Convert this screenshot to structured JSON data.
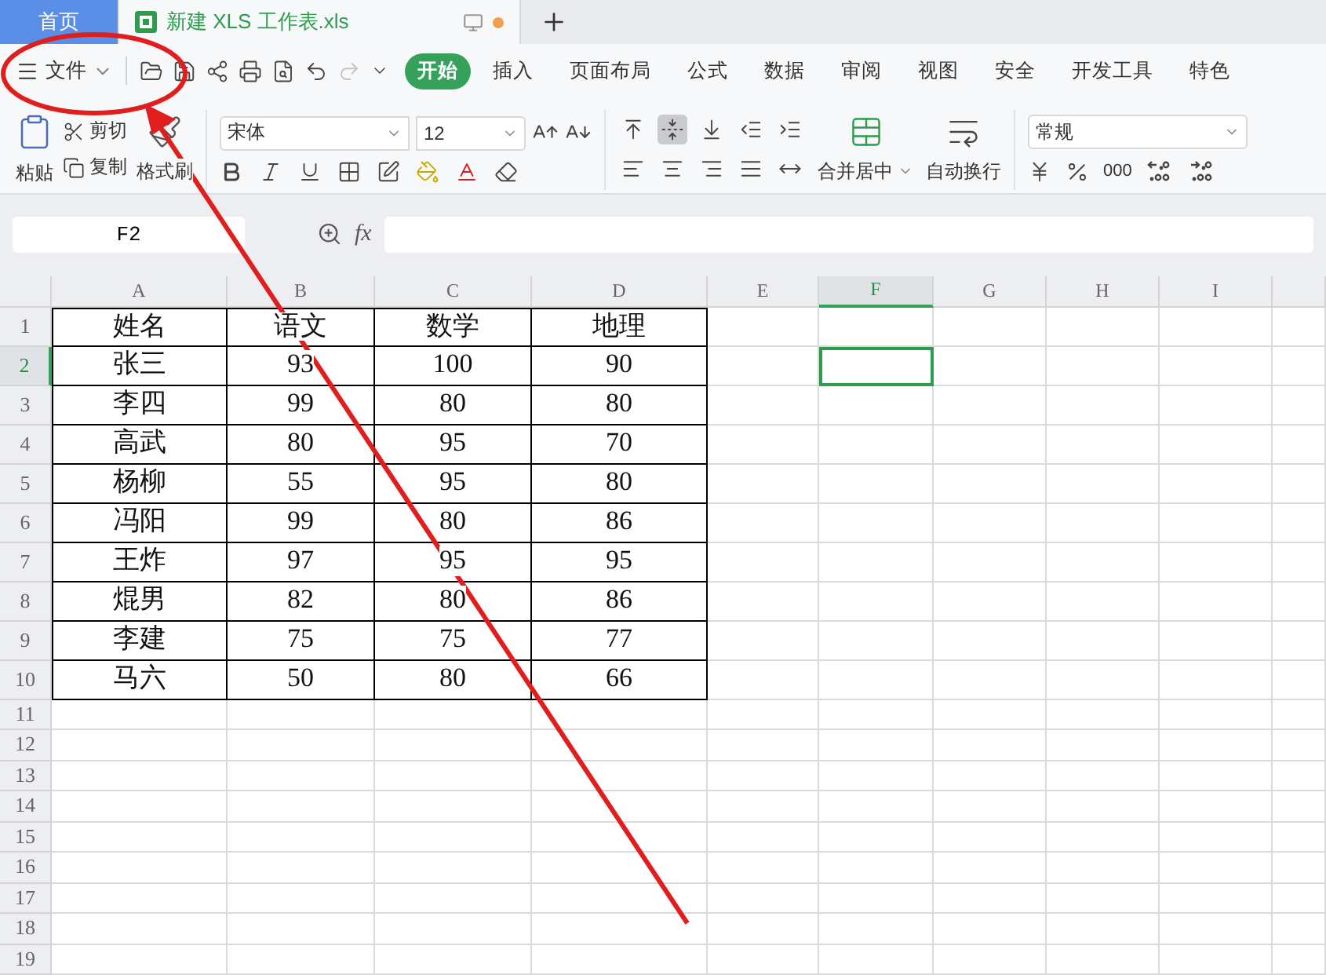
{
  "tabs": [
    {
      "label": "首页",
      "kind": "home",
      "selected": false,
      "unsaved": false
    },
    {
      "label": "新建 XLS 工作表.xls",
      "kind": "document",
      "selected": true,
      "unsaved": true
    }
  ],
  "file_menu": {
    "label": "文件"
  },
  "quick_access": [
    {
      "kind": "open",
      "disabled": false
    },
    {
      "kind": "save",
      "disabled": false
    },
    {
      "kind": "share",
      "disabled": false
    },
    {
      "kind": "print",
      "disabled": false
    },
    {
      "kind": "preview",
      "disabled": false
    },
    {
      "kind": "undo",
      "disabled": false
    },
    {
      "kind": "redo",
      "disabled": true
    },
    {
      "kind": "more",
      "disabled": false
    }
  ],
  "ribbon_tabs": [
    {
      "label": "开始",
      "selected": true
    },
    {
      "label": "插入",
      "selected": false
    },
    {
      "label": "页面布局",
      "selected": false
    },
    {
      "label": "公式",
      "selected": false
    },
    {
      "label": "数据",
      "selected": false
    },
    {
      "label": "审阅",
      "selected": false
    },
    {
      "label": "视图",
      "selected": false
    },
    {
      "label": "安全",
      "selected": false
    },
    {
      "label": "开发工具",
      "selected": false
    },
    {
      "label": "特色",
      "selected": false
    }
  ],
  "clipboard": {
    "paste": "粘贴",
    "cut": "剪切",
    "copy": "复制",
    "format_painter": "格式刷"
  },
  "font": {
    "name": "宋体",
    "size": "12"
  },
  "alignment": {
    "merge": "合并居中",
    "wrap": "自动换行"
  },
  "number_format": {
    "value": "常规",
    "thousands": "000"
  },
  "formula_bar": {
    "name_box": "F2",
    "fx_label": "fx"
  },
  "sheet": {
    "columns": [
      {
        "label": "A",
        "selected": false
      },
      {
        "label": "B",
        "selected": false
      },
      {
        "label": "C",
        "selected": false
      },
      {
        "label": "D",
        "selected": false
      },
      {
        "label": "E",
        "selected": false
      },
      {
        "label": "F",
        "selected": true
      },
      {
        "label": "G",
        "selected": false
      },
      {
        "label": "H",
        "selected": false
      },
      {
        "label": "I",
        "selected": false
      }
    ],
    "rows": [
      {
        "label": "1",
        "selected": false,
        "cells": [
          "姓名",
          "语文",
          "数学",
          "地理"
        ]
      },
      {
        "label": "2",
        "selected": true,
        "cells": [
          "张三",
          "93",
          "100",
          "90"
        ]
      },
      {
        "label": "3",
        "selected": false,
        "cells": [
          "李四",
          "99",
          "80",
          "80"
        ]
      },
      {
        "label": "4",
        "selected": false,
        "cells": [
          "高武",
          "80",
          "95",
          "70"
        ]
      },
      {
        "label": "5",
        "selected": false,
        "cells": [
          "杨柳",
          "55",
          "95",
          "80"
        ]
      },
      {
        "label": "6",
        "selected": false,
        "cells": [
          "冯阳",
          "99",
          "80",
          "86"
        ]
      },
      {
        "label": "7",
        "selected": false,
        "cells": [
          "王炸",
          "97",
          "95",
          "95"
        ]
      },
      {
        "label": "8",
        "selected": false,
        "cells": [
          "焜男",
          "82",
          "80",
          "86"
        ]
      },
      {
        "label": "9",
        "selected": false,
        "cells": [
          "李建",
          "75",
          "75",
          "77"
        ]
      },
      {
        "label": "10",
        "selected": false,
        "cells": [
          "马六",
          "50",
          "80",
          "66"
        ]
      },
      {
        "label": "11",
        "selected": false,
        "cells": []
      },
      {
        "label": "12",
        "selected": false,
        "cells": []
      },
      {
        "label": "13",
        "selected": false,
        "cells": []
      },
      {
        "label": "14",
        "selected": false,
        "cells": []
      },
      {
        "label": "15",
        "selected": false,
        "cells": []
      },
      {
        "label": "16",
        "selected": false,
        "cells": []
      },
      {
        "label": "17",
        "selected": false,
        "cells": []
      },
      {
        "label": "18",
        "selected": false,
        "cells": []
      },
      {
        "label": "19",
        "selected": false,
        "cells": []
      }
    ]
  }
}
